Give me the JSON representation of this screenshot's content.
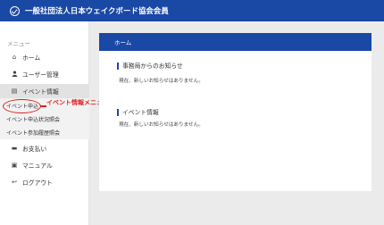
{
  "header": {
    "title": "一般社団法人日本ウェイクボード協会会員"
  },
  "sidebar": {
    "menu_title": "メニュー",
    "items": {
      "home": "ホーム",
      "user": "ユーザー管理",
      "event": "イベント情報",
      "pay": "お支払い",
      "manual": "マニュアル",
      "logout": "ログアウト"
    },
    "sub_items": {
      "apply": "イベント申込",
      "status": "イベント申込状況照会",
      "history": "イベント参加履歴照会"
    }
  },
  "annotation": {
    "text": "イベント情報メニューからイベント申込を選択",
    "color": "#e02020"
  },
  "main": {
    "panel_title": "ホーム",
    "sections": [
      {
        "title": "事務局からのお知らせ",
        "body": "現在、新しいお知らせはありません。"
      },
      {
        "title": "イベント情報",
        "body": "現在、新しいお知らせはありません。"
      }
    ]
  },
  "colors": {
    "brand": "#1a48a5"
  }
}
